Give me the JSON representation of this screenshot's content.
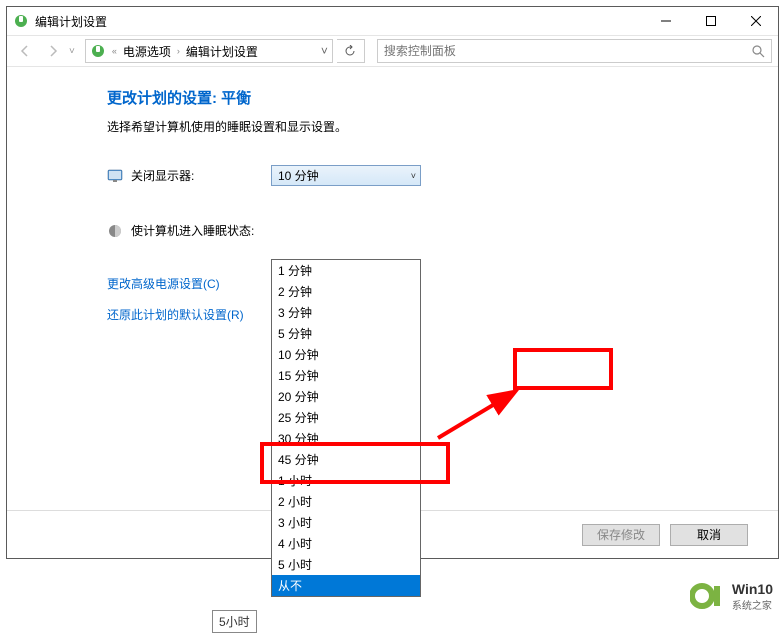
{
  "titlebar": {
    "title": "编辑计划设置"
  },
  "breadcrumb": {
    "item1": "电源选项",
    "item2": "编辑计划设置"
  },
  "search": {
    "placeholder": "搜索控制面板"
  },
  "page": {
    "title": "更改计划的设置: 平衡",
    "description": "选择希望计算机使用的睡眠设置和显示设置。"
  },
  "settings": {
    "display_off_label": "关闭显示器:",
    "display_off_value": "10 分钟",
    "sleep_label": "使计算机进入睡眠状态:"
  },
  "dropdown_options": [
    "1 分钟",
    "2 分钟",
    "3 分钟",
    "5 分钟",
    "10 分钟",
    "15 分钟",
    "20 分钟",
    "25 分钟",
    "30 分钟",
    "45 分钟",
    "1 小时",
    "2 小时",
    "3 小时",
    "4 小时",
    "5 小时",
    "从不"
  ],
  "highlighted_option_index": 15,
  "links": {
    "advanced": "更改高级电源设置(C)",
    "restore": "还原此计划的默认设置(R)"
  },
  "buttons": {
    "save": "保存修改",
    "cancel": "取消"
  },
  "watermark": {
    "top": "Win10",
    "bottom": "系统之家"
  },
  "truncated": "5小时"
}
